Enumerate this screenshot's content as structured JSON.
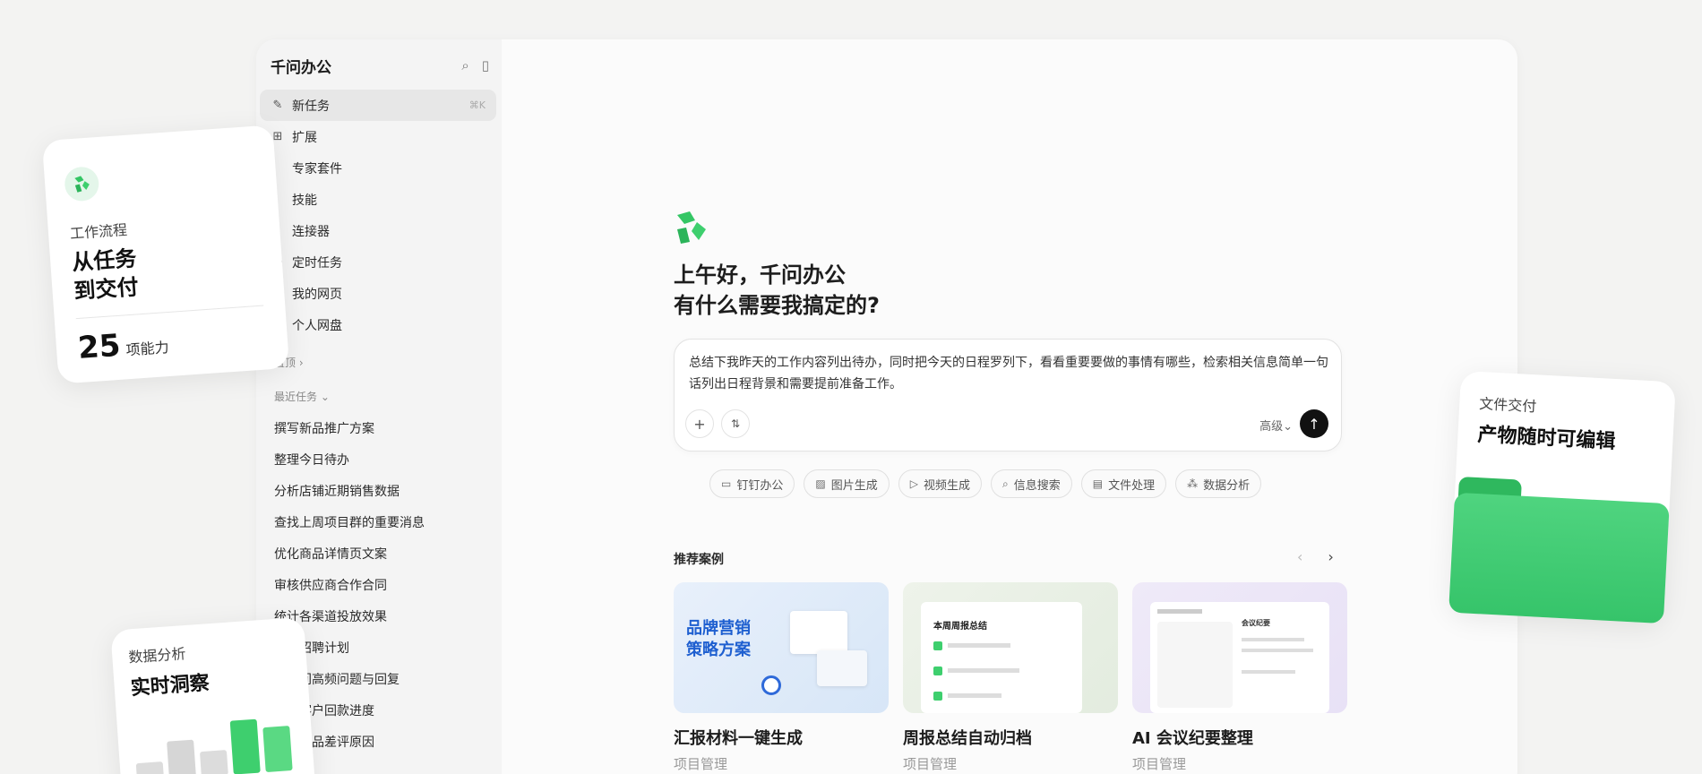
{
  "app": {
    "brand": "千问办公"
  },
  "sidebar": {
    "new_task": {
      "label": "新任务",
      "shortcut": "⌘K"
    },
    "extend": "扩展",
    "sub_items": [
      "专家套件",
      "技能",
      "连接器"
    ],
    "items": [
      "定时任务",
      "我的网页",
      "个人网盘"
    ],
    "pinned": "置顶 ›",
    "recent_label": "最近任务 ⌄",
    "recent_tasks": [
      "撰写新品推广方案",
      "整理今日待办",
      "分析店铺近期销售数据",
      "查找上周项目群的重要消息",
      "优化商品详情页文案",
      "审核供应商合作合同",
      "统计各渠道投放效果",
      "半年招聘计划",
      "直播间高频问题与回复",
      "重点客户回款进度",
      "本期商品差评原因"
    ]
  },
  "main": {
    "greeting_line1": "上午好，千问办公",
    "greeting_line2": "有什么需要我搞定的?",
    "compose_text": "总结下我昨天的工作内容列出待办，同时把今天的日程罗列下，看看重要要做的事情有哪些，检索相关信息简单一句话列出日程背景和需要提前准备工作。",
    "advanced": "高级⌄",
    "chips": [
      "钉钉办公",
      "图片生成",
      "视频生成",
      "信息搜索",
      "文件处理",
      "数据分析"
    ],
    "rec_title": "推荐案例",
    "cards": [
      {
        "title": "汇报材料一键生成",
        "sub": "项目管理",
        "thumb_text": "品牌营销\n策略方案"
      },
      {
        "title": "周报总结自动归档",
        "sub": "项目管理",
        "thumb_text": "本周周报总结"
      },
      {
        "title": "AI 会议纪要整理",
        "sub": "项目管理",
        "thumb_text": "会议纪要"
      }
    ]
  },
  "floats": {
    "workflow": {
      "label": "工作流程",
      "title1": "从任务",
      "title2": "到交付",
      "count": "25",
      "unit": "项能力"
    },
    "data": {
      "label": "数据分析",
      "title": "实时洞察"
    },
    "file": {
      "label": "文件交付",
      "title": "产物随时可编辑"
    }
  },
  "colors": {
    "accent": "#3ecf6e"
  }
}
